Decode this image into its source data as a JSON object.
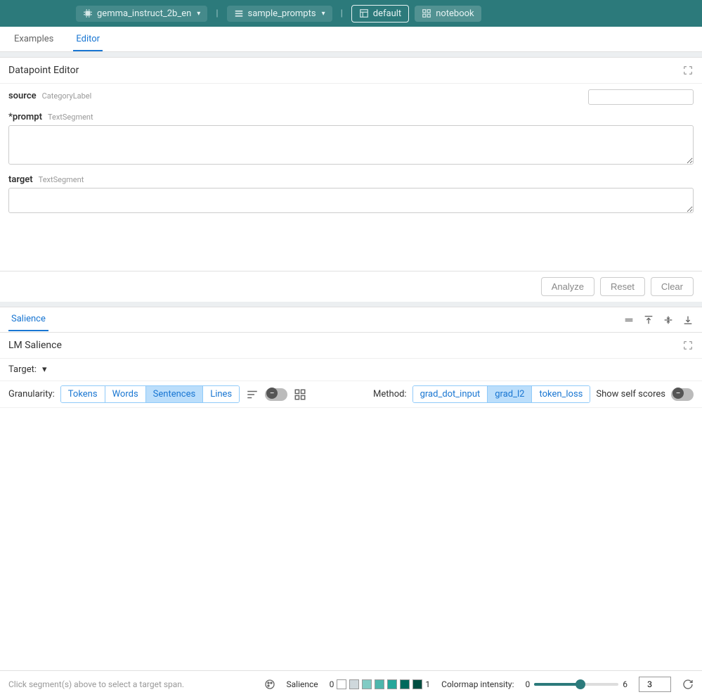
{
  "header": {
    "model": "gemma_instruct_2b_en",
    "dataset": "sample_prompts",
    "layout": "default",
    "notebook": "notebook"
  },
  "tabs_top": {
    "examples": "Examples",
    "editor": "Editor"
  },
  "datapoint_editor": {
    "title": "Datapoint Editor",
    "source_label": "source",
    "source_type": "CategoryLabel",
    "source_value": "",
    "prompt_label": "*prompt",
    "prompt_type": "TextSegment",
    "prompt_value": "",
    "target_label": "target",
    "target_type": "TextSegment",
    "target_value": ""
  },
  "actions": {
    "analyze": "Analyze",
    "reset": "Reset",
    "clear": "Clear"
  },
  "salience_tab": "Salience",
  "lm_salience": {
    "title": "LM Salience",
    "target_label": "Target:",
    "granularity_label": "Granularity:",
    "granularity_options": [
      "Tokens",
      "Words",
      "Sentences",
      "Lines"
    ],
    "granularity_selected": "Sentences",
    "method_label": "Method:",
    "method_options": [
      "grad_dot_input",
      "grad_l2",
      "token_loss"
    ],
    "method_selected": "grad_l2",
    "show_self_scores": "Show self scores"
  },
  "footer": {
    "hint": "Click segment(s) above to select a target span.",
    "salience_label": "Salience",
    "legend_min": "0",
    "legend_max": "1",
    "legend_colors": [
      "#ffffff",
      "#cfd8dc",
      "#80cbc4",
      "#4db6ac",
      "#26a69a",
      "#00695c",
      "#004d40"
    ],
    "colormap_label": "Colormap intensity:",
    "slider_min": "0",
    "slider_max": "6",
    "intensity_value": "3"
  }
}
